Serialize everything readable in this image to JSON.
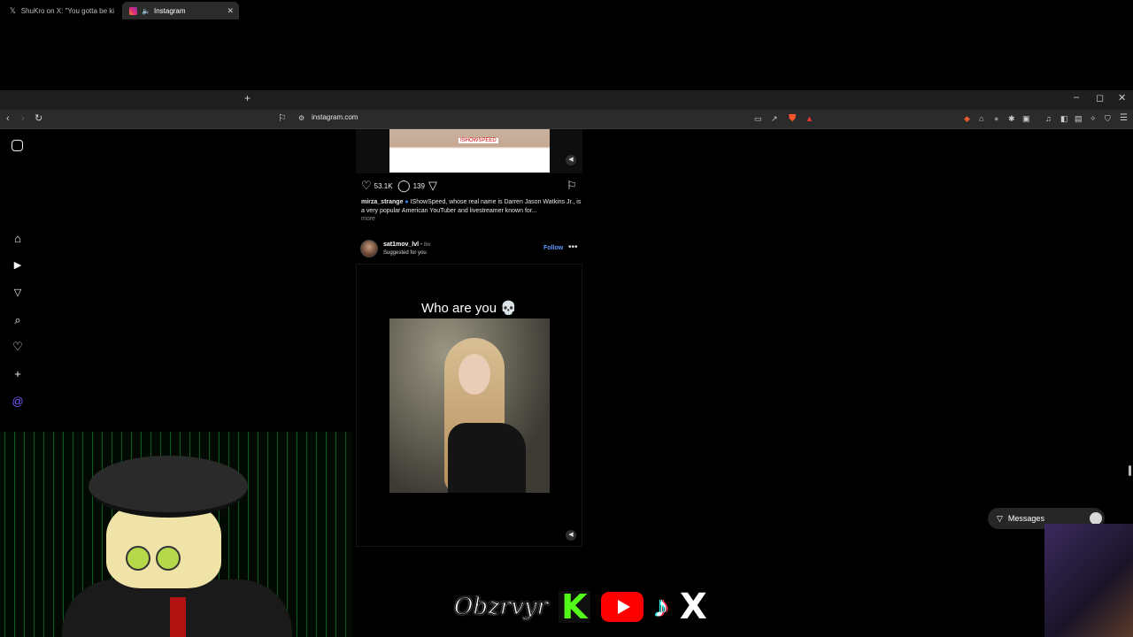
{
  "browser": {
    "tabs": [
      {
        "label": "ShuKro on X: \"You gotta be kidding",
        "icon": "x-logo-icon"
      },
      {
        "label": "Instagram",
        "icon": "instagram-icon",
        "active": true
      }
    ],
    "new_tab": "+",
    "url": "instagram.com",
    "window_controls": {
      "minimize": "–",
      "maximize": "◻",
      "close": "✕"
    }
  },
  "feed": {
    "post1": {
      "thumbnail_tag": "ISHOWSPEED",
      "likes": "53.1K",
      "comments": "139",
      "caption_user": "mirza_strange",
      "caption_text": "IShowSpeed, whose real name is Darren Jason Watkins Jr., is a very popular American YouTuber and livestreamer known for...",
      "more": "more"
    },
    "post2": {
      "username": "sat1mov_lvl",
      "age": "• 8w",
      "subtitle": "Suggested for you",
      "follow": "Follow",
      "overlay_text": "Who are you 💀"
    }
  },
  "messages": {
    "label": "Messages"
  },
  "overlay": {
    "brand": "Obzrvyr"
  }
}
